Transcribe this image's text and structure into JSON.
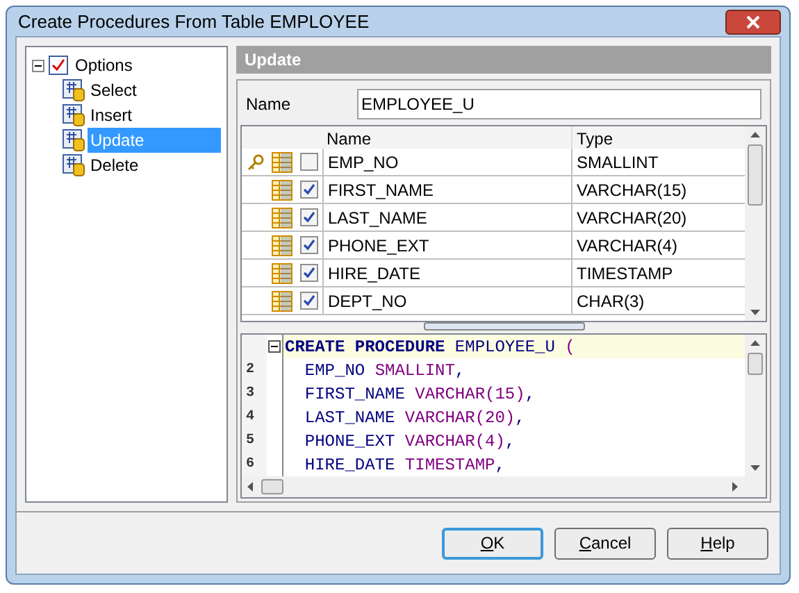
{
  "window": {
    "title": "Create Procedures From Table EMPLOYEE"
  },
  "tree": {
    "label": "Options",
    "expanded": true,
    "children": [
      {
        "label": "Select",
        "selected": false
      },
      {
        "label": "Insert",
        "selected": false
      },
      {
        "label": "Update",
        "selected": true
      },
      {
        "label": "Delete",
        "selected": false
      }
    ]
  },
  "section": {
    "title": "Update"
  },
  "name_field": {
    "label": "Name",
    "value": "EMPLOYEE_U"
  },
  "grid": {
    "columns": [
      "Name",
      "Type"
    ],
    "rows": [
      {
        "key": true,
        "checked": false,
        "name": "EMP_NO",
        "type": "SMALLINT"
      },
      {
        "key": false,
        "checked": true,
        "name": "FIRST_NAME",
        "type": "VARCHAR(15)"
      },
      {
        "key": false,
        "checked": true,
        "name": "LAST_NAME",
        "type": "VARCHAR(20)"
      },
      {
        "key": false,
        "checked": true,
        "name": "PHONE_EXT",
        "type": "VARCHAR(4)"
      },
      {
        "key": false,
        "checked": true,
        "name": "HIRE_DATE",
        "type": "TIMESTAMP"
      },
      {
        "key": false,
        "checked": true,
        "name": "DEPT_NO",
        "type": "CHAR(3)"
      }
    ]
  },
  "code": {
    "lines": [
      {
        "current": true,
        "tokens": [
          {
            "kind": "keyword",
            "text": "CREATE PROCEDURE"
          },
          {
            "kind": "plain",
            "text": " EMPLOYEE_U "
          },
          {
            "kind": "type",
            "text": "("
          }
        ]
      },
      {
        "current": false,
        "number": "2",
        "tokens": [
          {
            "kind": "plain",
            "text": "  EMP_NO "
          },
          {
            "kind": "type",
            "text": "SMALLINT"
          },
          {
            "kind": "plain",
            "text": ","
          }
        ]
      },
      {
        "current": false,
        "number": "3",
        "tokens": [
          {
            "kind": "plain",
            "text": "  FIRST_NAME "
          },
          {
            "kind": "type",
            "text": "VARCHAR(15)"
          },
          {
            "kind": "plain",
            "text": ","
          }
        ]
      },
      {
        "current": false,
        "number": "4",
        "tokens": [
          {
            "kind": "plain",
            "text": "  LAST_NAME "
          },
          {
            "kind": "type",
            "text": "VARCHAR(20)"
          },
          {
            "kind": "plain",
            "text": ","
          }
        ]
      },
      {
        "current": false,
        "number": "5",
        "tokens": [
          {
            "kind": "plain",
            "text": "  PHONE_EXT "
          },
          {
            "kind": "type",
            "text": "VARCHAR(4)"
          },
          {
            "kind": "plain",
            "text": ","
          }
        ]
      },
      {
        "current": false,
        "number": "6",
        "tokens": [
          {
            "kind": "plain",
            "text": "  HIRE_DATE "
          },
          {
            "kind": "type",
            "text": "TIMESTAMP"
          },
          {
            "kind": "plain",
            "text": ","
          }
        ]
      }
    ]
  },
  "buttons": [
    {
      "accel": "O",
      "rest": "K",
      "default": true
    },
    {
      "accel": "C",
      "rest": "ancel",
      "default": false
    },
    {
      "accel": "H",
      "rest": "elp",
      "default": false
    }
  ]
}
